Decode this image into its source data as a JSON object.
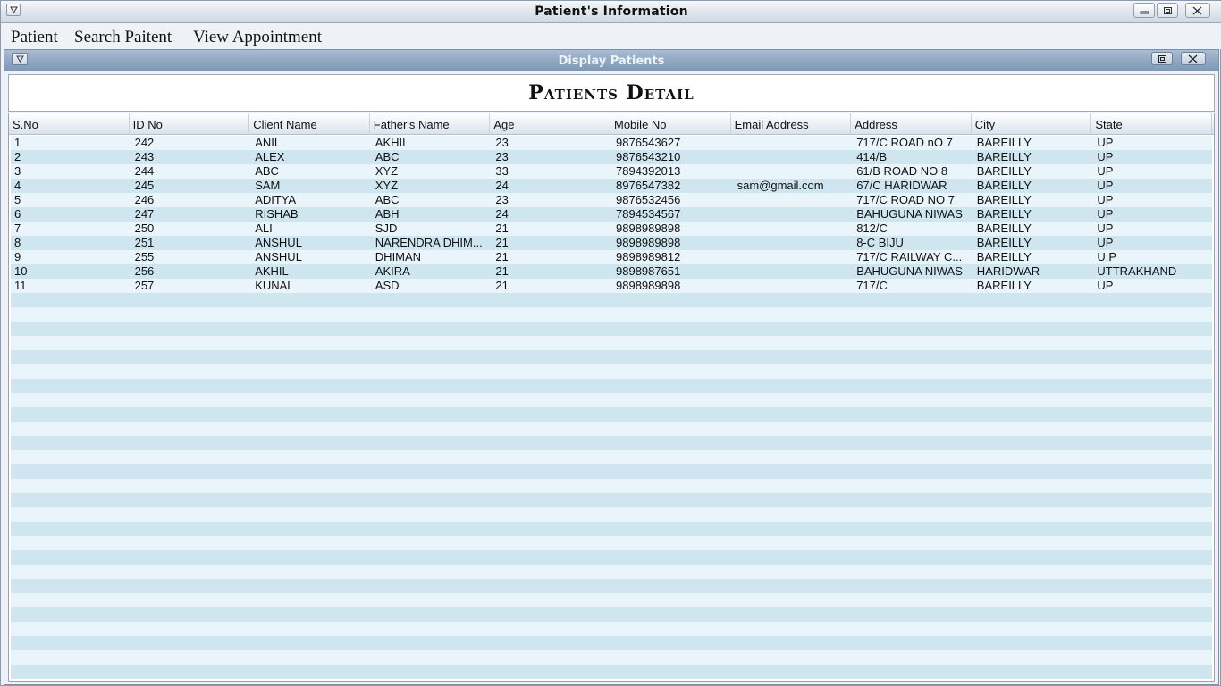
{
  "window": {
    "title": "Patient's Information"
  },
  "menubar": {
    "items": [
      "Patient",
      "Search Paitent",
      "View Appointment"
    ]
  },
  "inner_window": {
    "title": "Display Patients"
  },
  "page": {
    "heading": "Patients Detail"
  },
  "table": {
    "columns": [
      "S.No",
      "ID No",
      "Client Name",
      "Father's Name",
      "Age",
      "Mobile No",
      "Email Address",
      "Address",
      "City",
      "State"
    ],
    "rows": [
      [
        "1",
        "242",
        "ANIL",
        "AKHIL",
        "23",
        "9876543627",
        "",
        "717/C ROAD nO 7",
        "BAREILLY",
        "UP"
      ],
      [
        "2",
        "243",
        "ALEX",
        "ABC",
        "23",
        "9876543210",
        "",
        "414/B",
        "BAREILLY",
        "UP"
      ],
      [
        "3",
        "244",
        "ABC",
        "XYZ",
        "33",
        "7894392013",
        "",
        "61/B ROAD NO 8",
        "BAREILLY",
        "UP"
      ],
      [
        "4",
        "245",
        "SAM",
        "XYZ",
        "24",
        "8976547382",
        "sam@gmail.com",
        "67/C HARIDWAR",
        "BAREILLY",
        "UP"
      ],
      [
        "5",
        "246",
        "ADITYA",
        "ABC",
        "23",
        "9876532456",
        "",
        "717/C ROAD NO 7",
        "BAREILLY",
        "UP"
      ],
      [
        "6",
        "247",
        "RISHAB",
        "ABH",
        "24",
        "7894534567",
        "",
        "BAHUGUNA NIWAS",
        "BAREILLY",
        "UP"
      ],
      [
        "7",
        "250",
        "ALI",
        "SJD",
        "21",
        "9898989898",
        "",
        "812/C",
        "BAREILLY",
        "UP"
      ],
      [
        "8",
        "251",
        "ANSHUL",
        "NARENDRA DHIM...",
        "21",
        "9898989898",
        "",
        "8-C BIJU",
        "BAREILLY",
        "UP"
      ],
      [
        "9",
        "255",
        "ANSHUL",
        "DHIMAN",
        "21",
        "9898989812",
        "",
        "717/C RAILWAY C...",
        "BAREILLY",
        "U.P"
      ],
      [
        "10",
        "256",
        "AKHIL",
        "AKIRA",
        "21",
        "9898987651",
        "",
        "BAHUGUNA NIWAS",
        "HARIDWAR",
        "UTTRAKHAND"
      ],
      [
        "11",
        "257",
        "KUNAL",
        "ASD",
        "21",
        "9898989898",
        "",
        "717/C",
        "BAREILLY",
        "UP"
      ]
    ],
    "row_colors": {
      "odd": "#cfe6f0",
      "even": "#eaf5fb"
    }
  },
  "icons": [
    "system-menu-icon",
    "minimize-icon",
    "maximize-icon",
    "close-icon"
  ]
}
